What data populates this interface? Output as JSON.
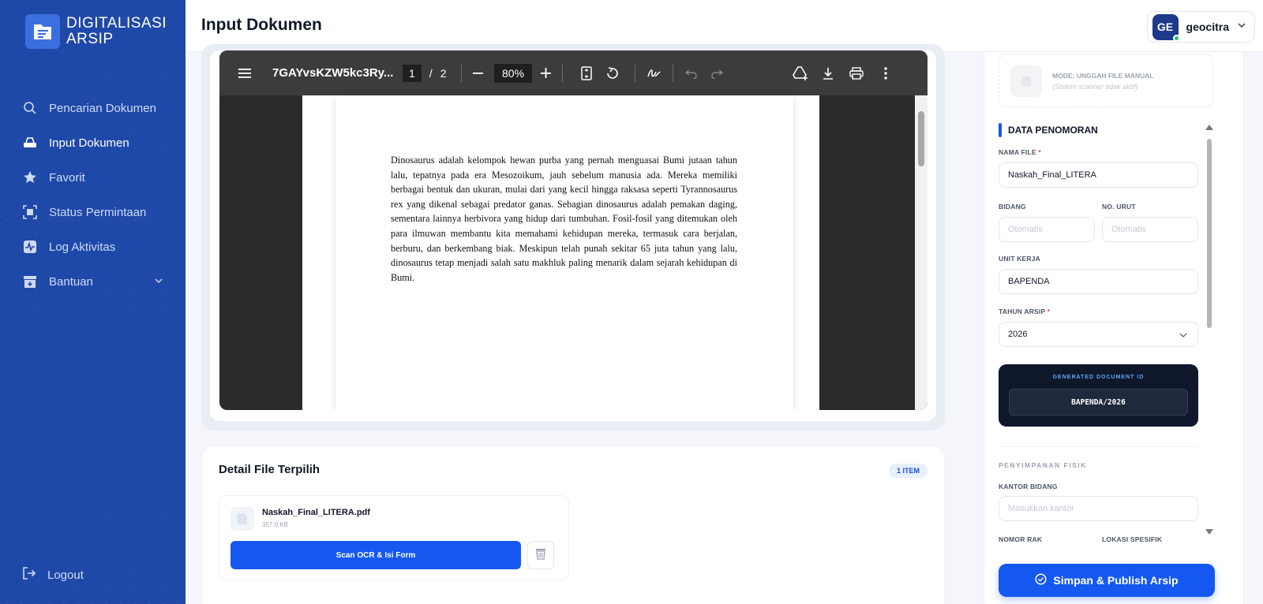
{
  "brand": {
    "line1": "DIGITALISASI",
    "line2": "ARSIP"
  },
  "sidebar": {
    "items": [
      {
        "label": "Pencarian Dokumen",
        "icon": "search-icon"
      },
      {
        "label": "Input Dokumen",
        "icon": "scanner-icon"
      },
      {
        "label": "Favorit",
        "icon": "star-icon"
      },
      {
        "label": "Status Permintaan",
        "icon": "document-scan-icon"
      },
      {
        "label": "Log Aktivitas",
        "icon": "activity-icon"
      },
      {
        "label": "Bantuan",
        "icon": "archive-box-icon"
      }
    ],
    "logout": "Logout"
  },
  "header": {
    "title": "Input Dokumen",
    "user_initials": "GE",
    "user_name": "geocitra"
  },
  "pdf_viewer": {
    "file_title": "7GAYvsKZW5kc3Ry...",
    "current_page": "1",
    "page_separator": "/",
    "total_pages": "2",
    "zoom": "80%",
    "page_text": "Dinosaurus adalah kelompok hewan purba yang pernah menguasai Bumi jutaan tahun lalu, tepatnya pada era Mesozoikum, jauh sebelum manusia ada. Mereka memiliki berbagai bentuk dan ukuran, mulai dari yang kecil hingga raksasa seperti Tyrannosaurus rex yang dikenal sebagai predator ganas. Sebagian dinosaurus adalah pemakan daging, sementara lainnya herbivora yang hidup dari tumbuhan. Fosil-fosil yang ditemukan oleh para ilmuwan membantu kita memahami kehidupan mereka, termasuk cara berjalan, berburu, dan berkembang biak. Meskipun telah punah sekitar 65 juta tahun yang lalu, dinosaurus tetap menjadi salah satu makhluk paling menarik dalam sejarah kehidupan di Bumi."
  },
  "detail": {
    "title": "Detail File Terpilih",
    "badge": "1 ITEM",
    "file_name": "Naskah_Final_LITERA.pdf",
    "file_size": "357.0 KB",
    "scan_button": "Scan OCR & Isi Form"
  },
  "form": {
    "mode_title": "MODE: UNGGAH FILE MANUAL",
    "mode_sub": "(Sistem scanner tidak aktif)",
    "section_title": "DATA PENOMORAN",
    "nama_file_label": "NAMA FILE",
    "required_mark": "*",
    "nama_file_value": "Naskah_Final_LITERA",
    "bidang_label": "BIDANG",
    "bidang_placeholder": "Otomatis",
    "no_urut_label": "NO. URUT",
    "no_urut_placeholder": "Otomatis",
    "unit_kerja_label": "UNIT KERJA",
    "unit_kerja_value": "BAPENDA",
    "tahun_label": "TAHUN ARSIP",
    "tahun_value": "2026",
    "doc_id_label": "GENERATED DOCUMENT ID",
    "doc_id_value": "BAPENDA/2026",
    "storage_head": "PENYIMPANAN FISIK",
    "kantor_label": "KANTOR BIDANG",
    "kantor_placeholder": "Masukkan kantor",
    "nomor_rak_label": "NOMOR RAK",
    "lokasi_label": "LOKASI SPESIFIK",
    "publish_button": "Simpan & Publish Arsip"
  },
  "colors": {
    "sidebar": "#1f49a8",
    "accent": "#1558f0",
    "doc_id_bg": "#0f172a"
  }
}
